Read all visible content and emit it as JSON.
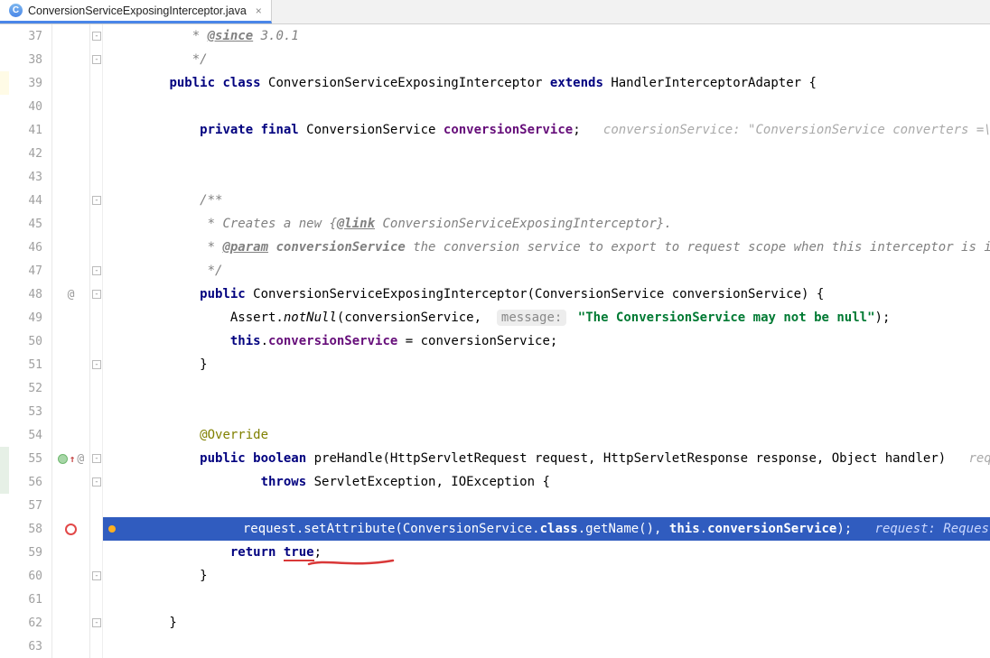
{
  "tab": {
    "filename": "ConversionServiceExposingInterceptor.java",
    "close": "×",
    "icon_letter": "C"
  },
  "gutter": {
    "start": 37,
    "end": 63,
    "marks": {
      "48": [
        "at"
      ],
      "55": [
        "override",
        "up",
        "at"
      ],
      "58": [
        "breakpoint",
        "exec-dot"
      ]
    }
  },
  "code": {
    "37": {
      "seg": [
        [
          "",
          "          "
        ],
        [
          "cm",
          " * "
        ],
        [
          "doc-tag",
          "@since"
        ],
        [
          "cm",
          " 3.0.1"
        ]
      ]
    },
    "38": {
      "seg": [
        [
          "",
          "          "
        ],
        [
          "cm",
          " */"
        ]
      ]
    },
    "39": {
      "seg": [
        [
          "",
          "        "
        ],
        [
          "kw",
          "public class "
        ],
        [
          "",
          "ConversionServiceExposingInterceptor "
        ],
        [
          "kw",
          "extends "
        ],
        [
          "",
          "HandlerInterceptorAdapter {"
        ]
      ]
    },
    "40": {
      "seg": [
        [
          "",
          ""
        ]
      ]
    },
    "41": {
      "seg": [
        [
          "",
          "            "
        ],
        [
          "kw",
          "private final "
        ],
        [
          "",
          "ConversionService "
        ],
        [
          "pn",
          "conversionService"
        ],
        [
          "",
          ";   "
        ],
        [
          "hint",
          "conversionService: \"ConversionService converters =\\n\\t"
        ]
      ]
    },
    "42": {
      "seg": [
        [
          "",
          ""
        ]
      ]
    },
    "43": {
      "seg": [
        [
          "",
          ""
        ]
      ]
    },
    "44": {
      "seg": [
        [
          "",
          "            "
        ],
        [
          "cm",
          "/**"
        ]
      ]
    },
    "45": {
      "seg": [
        [
          "",
          "            "
        ],
        [
          "cm",
          " * Creates a new {"
        ],
        [
          "doc-tag",
          "@link"
        ],
        [
          "cm",
          " ConversionServiceExposingInterceptor}."
        ]
      ]
    },
    "46": {
      "seg": [
        [
          "",
          "            "
        ],
        [
          "cm",
          " * "
        ],
        [
          "doc-tag",
          "@param"
        ],
        [
          "cm",
          " "
        ],
        [
          "cmb",
          "conversionService"
        ],
        [
          "cm",
          " the conversion service to export to request scope when this interceptor is inv"
        ]
      ]
    },
    "47": {
      "seg": [
        [
          "",
          "            "
        ],
        [
          "cm",
          " */"
        ]
      ]
    },
    "48": {
      "seg": [
        [
          "",
          "            "
        ],
        [
          "kw",
          "public "
        ],
        [
          "",
          "ConversionServiceExposingInterceptor(ConversionService conversionService) {"
        ]
      ]
    },
    "49": {
      "seg": [
        [
          "",
          "                "
        ],
        [
          "",
          "Assert."
        ],
        [
          "mi",
          "notNull"
        ],
        [
          "",
          "(conversionService,  "
        ],
        [
          "pill",
          "message:"
        ],
        [
          "",
          " "
        ],
        [
          "str",
          "\"The ConversionService may not be null\""
        ],
        [
          "",
          ");"
        ]
      ]
    },
    "50": {
      "seg": [
        [
          "",
          "                "
        ],
        [
          "kw",
          "this"
        ],
        [
          "",
          "."
        ],
        [
          "pn",
          "conversionService"
        ],
        [
          "",
          " = conversionService;"
        ]
      ]
    },
    "51": {
      "seg": [
        [
          "",
          "            }"
        ]
      ]
    },
    "52": {
      "seg": [
        [
          "",
          ""
        ]
      ]
    },
    "53": {
      "seg": [
        [
          "",
          ""
        ]
      ]
    },
    "54": {
      "seg": [
        [
          "",
          "            "
        ],
        [
          "ann",
          "@Override"
        ]
      ]
    },
    "55": {
      "seg": [
        [
          "",
          "            "
        ],
        [
          "kw",
          "public boolean "
        ],
        [
          "",
          "preHandle(HttpServletRequest request, HttpServletResponse response, Object handler)   "
        ],
        [
          "hint",
          "reques"
        ]
      ]
    },
    "56": {
      "seg": [
        [
          "",
          "                    "
        ],
        [
          "kw",
          "throws "
        ],
        [
          "",
          "ServletException, IOException {"
        ]
      ]
    },
    "57": {
      "seg": [
        [
          "",
          ""
        ]
      ]
    },
    "58": {
      "exec": true,
      "seg": [
        [
          "",
          "                "
        ],
        [
          "",
          "request.setAttribute(ConversionService."
        ],
        [
          "kw",
          "class"
        ],
        [
          "",
          ".getName(), "
        ],
        [
          "kw",
          "this"
        ],
        [
          "",
          "."
        ],
        [
          "pn",
          "conversionService"
        ],
        [
          "",
          ");   "
        ],
        [
          "hint",
          "request: RequestFaca"
        ]
      ]
    },
    "59": {
      "seg": [
        [
          "",
          "                "
        ],
        [
          "kw",
          "return "
        ],
        [
          "sq",
          "true"
        ],
        [
          "",
          ";"
        ]
      ]
    },
    "60": {
      "seg": [
        [
          "",
          "            }"
        ]
      ]
    },
    "61": {
      "seg": [
        [
          "",
          ""
        ]
      ]
    },
    "62": {
      "seg": [
        [
          "",
          "        }"
        ]
      ]
    },
    "63": {
      "seg": [
        [
          "",
          ""
        ]
      ]
    }
  },
  "leftstrip": {
    "39": "sel-bg-yellow",
    "55": "sel-bg-light",
    "56": "sel-bg-light"
  },
  "folds": {
    "37": "br-top",
    "38": "minus",
    "44": "minus",
    "47": "minus",
    "48": "minus",
    "51": "minus",
    "55": "minus",
    "56": "minus",
    "60": "minus",
    "62": "minus"
  }
}
